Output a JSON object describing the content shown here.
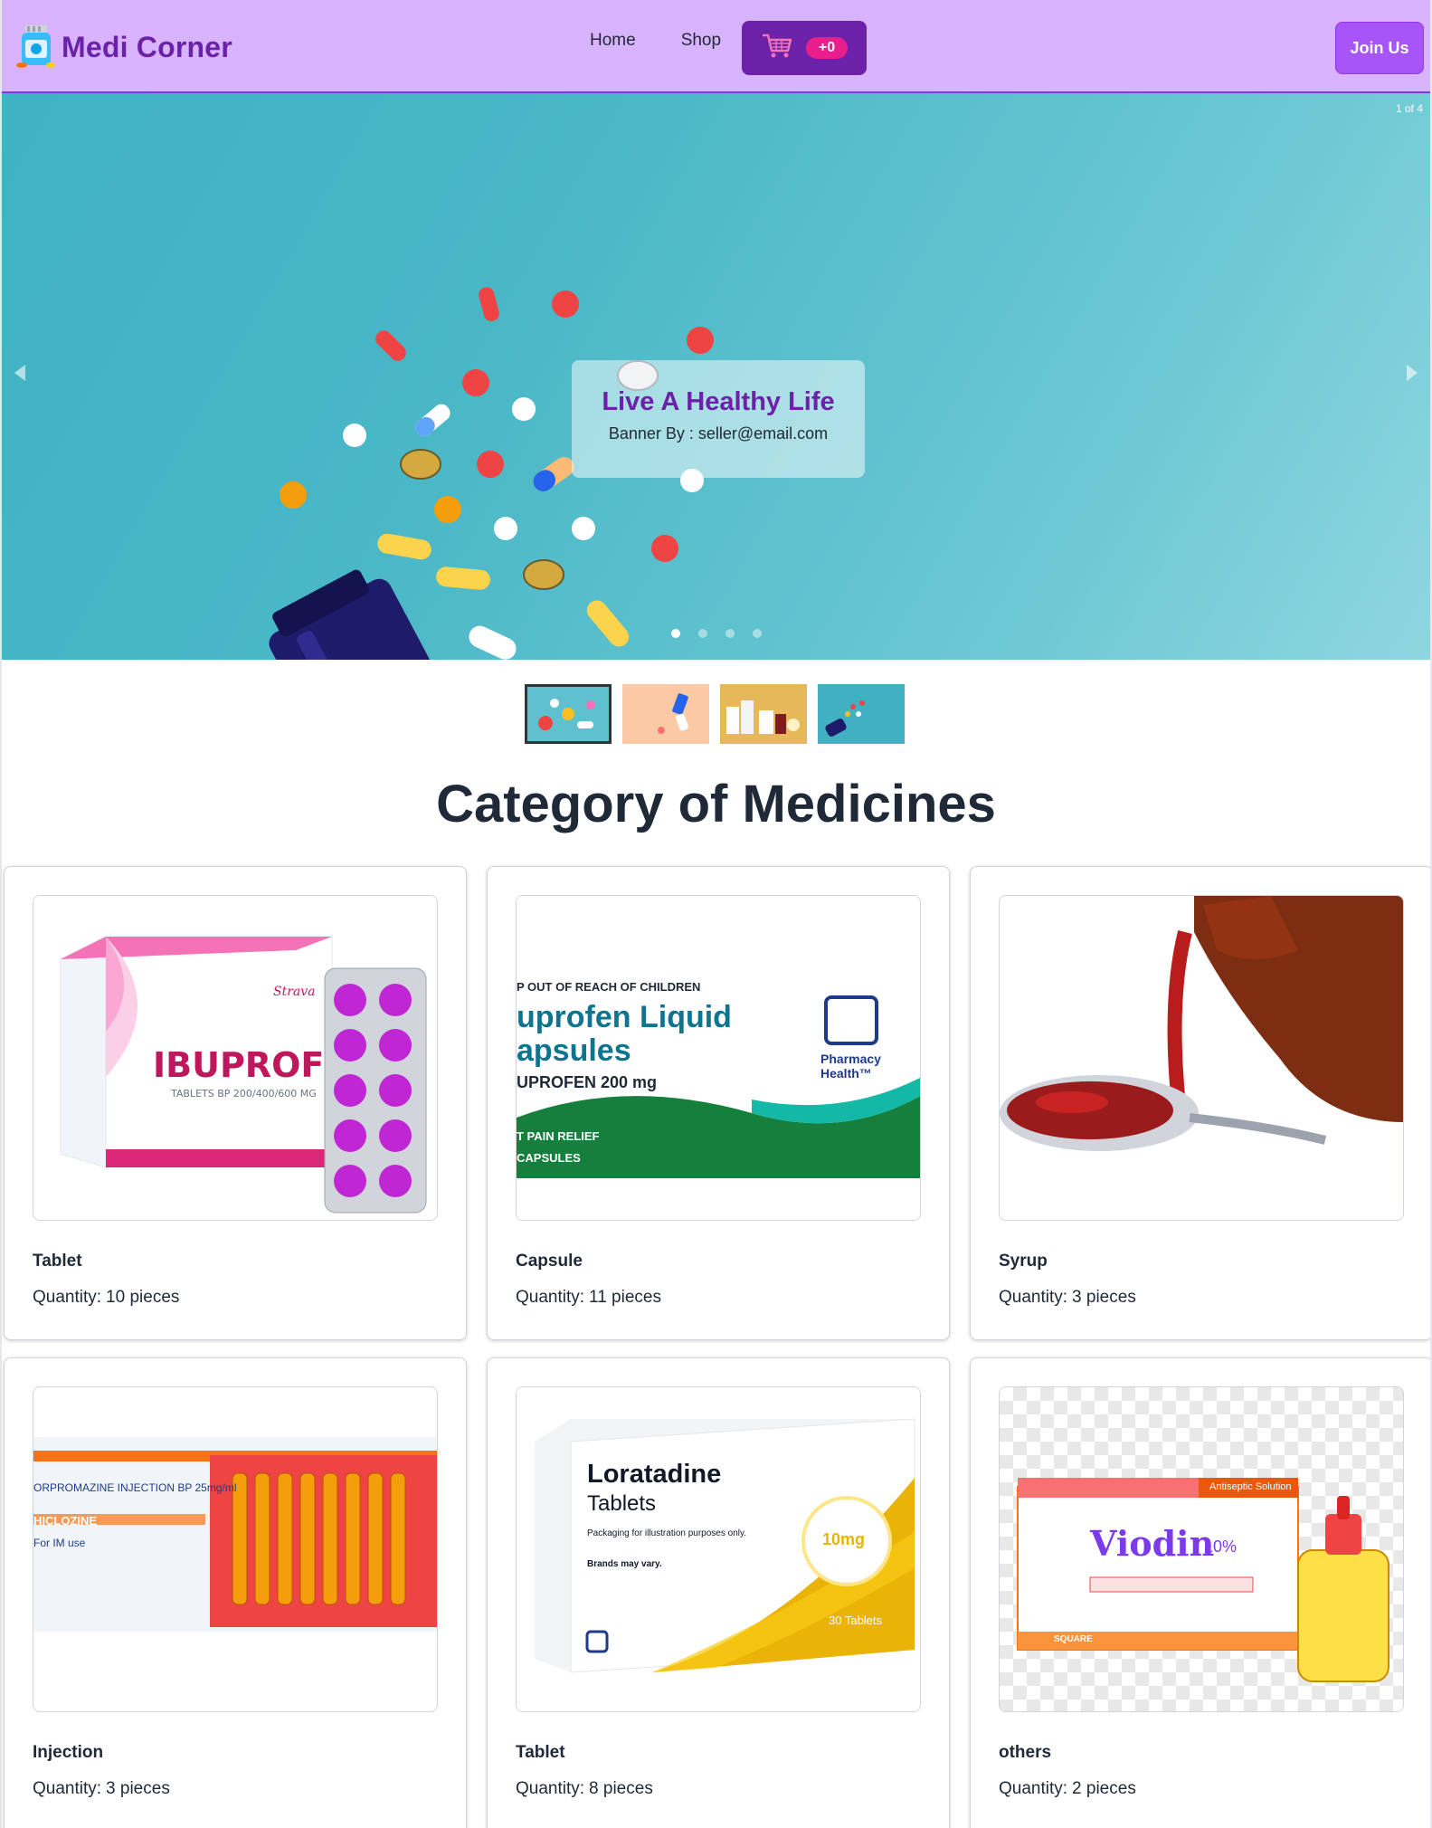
{
  "navbar": {
    "brand": "Medi Corner",
    "links": [
      "Home",
      "Shop"
    ],
    "cart_count": "+0",
    "join_label": "Join Us"
  },
  "banner": {
    "counter": "1 of 4",
    "title": "Live A Healthy Life",
    "subtitle": "Banner By : seller@email.com",
    "active_slide": 1,
    "slide_count": 4
  },
  "section_title": "Category of Medicines",
  "quantity_label": "Quantity:",
  "categories": [
    {
      "name": "Tablet",
      "quantity": "10 pieces",
      "image": "ibuprofen-tablets-box"
    },
    {
      "name": "Capsule",
      "quantity": "11 pieces",
      "image": "ibuprofen-liquid-capsules-box",
      "image_text": {
        "warning": "P OUT OF REACH OF CHILDREN",
        "line1": "uprofen Liquid",
        "line2": "apsules",
        "dose": "UPROFEN 200 mg",
        "brand": "Pharmacy Health™",
        "strip1": "T PAIN RELIEF",
        "strip2": "CAPSULES"
      }
    },
    {
      "name": "Syrup",
      "quantity": "3 pieces",
      "image": "syrup-pouring-spoon"
    },
    {
      "name": "Injection",
      "quantity": "3 pieces",
      "image": "injection-ampoules-box",
      "image_text": {
        "line1": "ORPROMAZINE INJECTION BP 25mg/ml",
        "line2": "HICLOZINE",
        "line3": "For IM use"
      }
    },
    {
      "name": "Tablet",
      "quantity": "8 pieces",
      "image": "loratadine-tablets-box",
      "image_text": {
        "title": "Loratadine",
        "subtitle": "Tablets",
        "note": "Packaging for illustration purposes only.",
        "note2": "Brands may vary.",
        "dose": "10mg",
        "count": "30 Tablets"
      }
    },
    {
      "name": "others",
      "quantity": "2 pieces",
      "image": "viodin-antiseptic-box",
      "image_text": {
        "brand": "Viodin",
        "pct": "10%",
        "tag": "Antiseptic Solution",
        "maker": "SQUARE"
      }
    }
  ],
  "colors": {
    "navbar": "#d8b4fe",
    "brand": "#6b21a8",
    "cart_button": "#6b21a8",
    "cart_badge": "#e91e8c",
    "join_button": "#a855f7",
    "banner_bg": "#49b7c6"
  }
}
